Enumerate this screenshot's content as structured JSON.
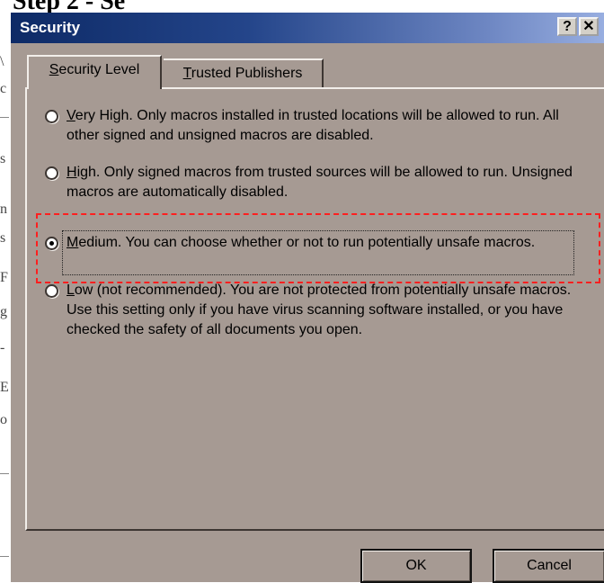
{
  "heading": "Step 2 - Se",
  "background_letters": [
    "\\",
    "c",
    "s",
    "n",
    "s",
    "F",
    "g",
    "-",
    "E",
    "o"
  ],
  "dialog": {
    "title": "Security",
    "help_button": "?",
    "close_button": "✕",
    "tabs": [
      {
        "label_underlined": "S",
        "label_rest": "ecurity Level",
        "active": true
      },
      {
        "label_underlined": "T",
        "label_rest": "rusted Publishers",
        "active": false
      }
    ],
    "options": [
      {
        "underlined": "V",
        "text_rest": "ery High. Only macros installed in trusted locations will be allowed to run. All other signed and unsigned macros are disabled.",
        "checked": false
      },
      {
        "underlined": "H",
        "text_rest": "igh. Only signed macros from trusted sources will be allowed to run. Unsigned macros are automatically disabled.",
        "checked": false
      },
      {
        "underlined": "M",
        "text_rest": "edium. You can choose whether or not to run potentially unsafe macros.",
        "checked": true
      },
      {
        "underlined": "L",
        "text_rest": "ow (not recommended). You are not protected from potentially unsafe macros. Use this setting only if you have virus scanning software installed, or you have checked the safety of all documents you open.",
        "checked": false
      }
    ],
    "ok_label": "OK",
    "cancel_label": "Cancel"
  },
  "colors": {
    "dialog_bg": "#a69a93",
    "titlebar_start": "#0d2a66",
    "titlebar_end": "#98aee0",
    "highlight": "#ff1f1f"
  }
}
